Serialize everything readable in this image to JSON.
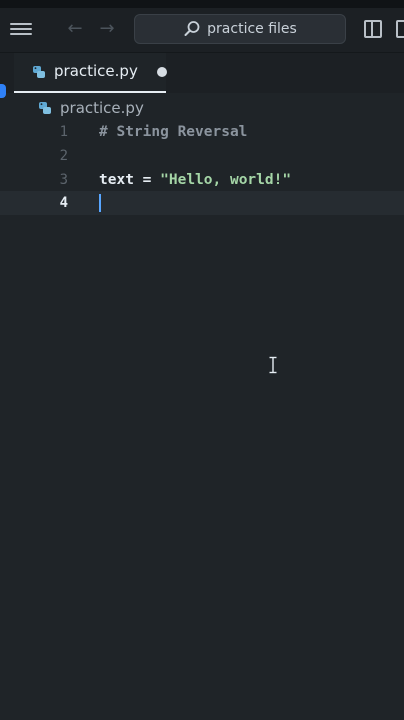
{
  "titlebar": {
    "search_placeholder": "practice files",
    "icons": [
      "menu-icon",
      "arrow-left-icon",
      "arrow-right-icon",
      "search-icon",
      "layout-sidebar-icon",
      "layout-panel-icon"
    ]
  },
  "tabs": [
    {
      "label": "practice.py",
      "modified": true,
      "active": true
    }
  ],
  "breadcrumb": {
    "file": "practice.py"
  },
  "editor": {
    "lines": [
      {
        "num": "1",
        "parts": [
          {
            "text": "# String Reversal",
            "kind": "comment"
          }
        ]
      },
      {
        "num": "2",
        "parts": []
      },
      {
        "num": "3",
        "parts": [
          {
            "text": "text",
            "kind": "var"
          },
          {
            "text": " = ",
            "kind": "op"
          },
          {
            "text": "\"Hello, world!\"",
            "kind": "str"
          }
        ]
      },
      {
        "num": "4",
        "parts": [],
        "active": true
      }
    ]
  },
  "colors": {
    "background": "#1f2428",
    "accent": "#2f81f7",
    "string": "#a5d6a7"
  }
}
